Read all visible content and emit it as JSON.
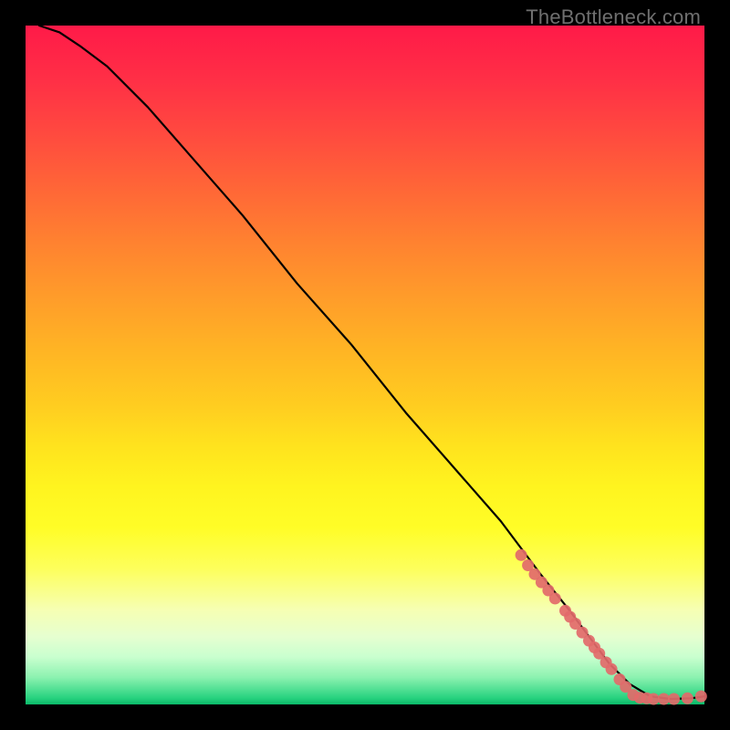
{
  "watermark": "TheBottleneck.com",
  "chart_data": {
    "type": "line",
    "title": "",
    "xlabel": "",
    "ylabel": "",
    "xlim": [
      0,
      100
    ],
    "ylim": [
      0,
      100
    ],
    "series": [
      {
        "name": "curve",
        "x": [
          2,
          5,
          8,
          12,
          18,
          25,
          32,
          40,
          48,
          56,
          63,
          70,
          76,
          80,
          83,
          86,
          89,
          92,
          95,
          98,
          100
        ],
        "y": [
          100,
          99,
          97,
          94,
          88,
          80,
          72,
          62,
          53,
          43,
          35,
          27,
          19,
          14,
          10,
          6,
          3,
          1.2,
          0.8,
          0.9,
          1.2
        ]
      }
    ],
    "markers": [
      {
        "x": 73,
        "y": 22.0
      },
      {
        "x": 74,
        "y": 20.5
      },
      {
        "x": 75,
        "y": 19.2
      },
      {
        "x": 76,
        "y": 18.0
      },
      {
        "x": 77,
        "y": 16.8
      },
      {
        "x": 78,
        "y": 15.6
      },
      {
        "x": 79.5,
        "y": 13.8
      },
      {
        "x": 80.2,
        "y": 12.9
      },
      {
        "x": 81,
        "y": 11.9
      },
      {
        "x": 82,
        "y": 10.6
      },
      {
        "x": 83,
        "y": 9.4
      },
      {
        "x": 83.8,
        "y": 8.4
      },
      {
        "x": 84.5,
        "y": 7.5
      },
      {
        "x": 85.5,
        "y": 6.2
      },
      {
        "x": 86.3,
        "y": 5.2
      },
      {
        "x": 87.5,
        "y": 3.7
      },
      {
        "x": 88.4,
        "y": 2.6
      },
      {
        "x": 89.5,
        "y": 1.4
      },
      {
        "x": 90.5,
        "y": 1.0
      },
      {
        "x": 91.5,
        "y": 0.9
      },
      {
        "x": 92.5,
        "y": 0.8
      },
      {
        "x": 94,
        "y": 0.8
      },
      {
        "x": 95.5,
        "y": 0.8
      },
      {
        "x": 97.5,
        "y": 0.9
      },
      {
        "x": 99.5,
        "y": 1.2
      }
    ],
    "colors": {
      "line": "#000000",
      "marker": "#e26a6a"
    }
  }
}
